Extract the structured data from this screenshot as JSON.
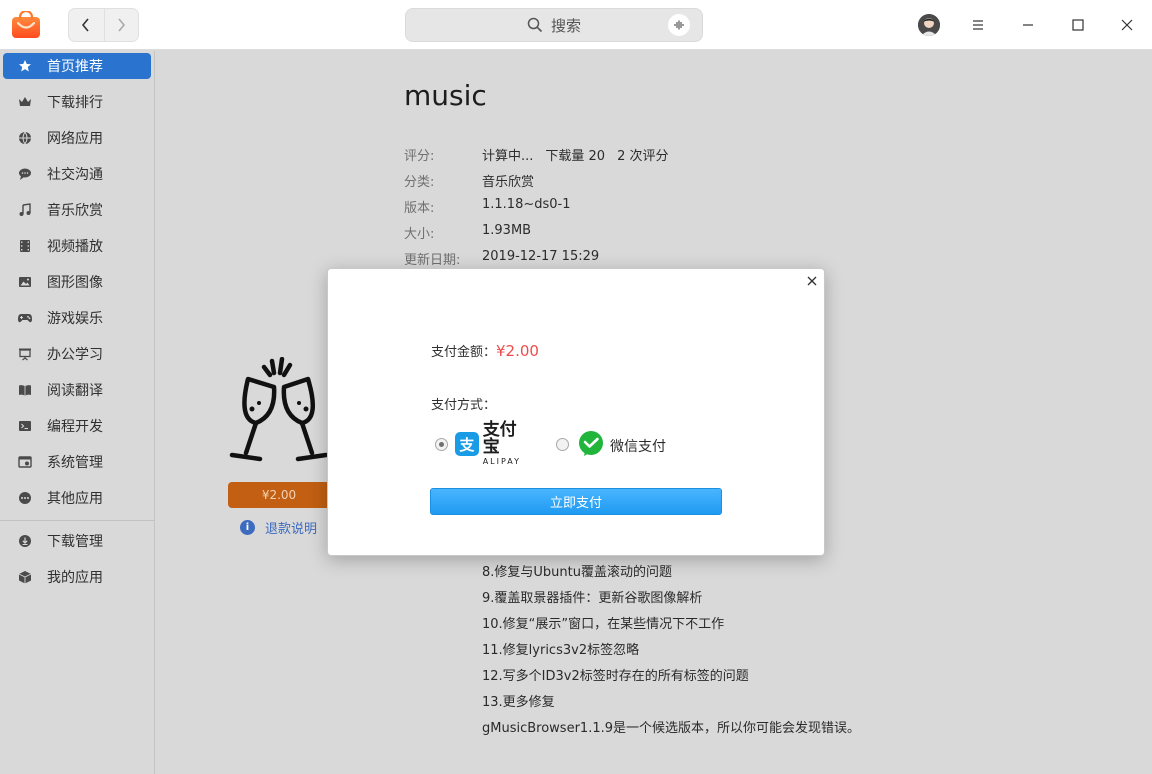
{
  "titlebar": {
    "search_label": "搜索",
    "icons": [
      "app-logo-icon",
      "back-icon",
      "forward-icon",
      "search-icon",
      "voice-icon",
      "avatar",
      "menu-icon",
      "minimize-icon",
      "maximize-icon",
      "close-icon"
    ]
  },
  "sidebar": {
    "items": [
      {
        "label": "首页推荐",
        "icon": "star-icon",
        "active": true
      },
      {
        "label": "下载排行",
        "icon": "crown-icon"
      },
      {
        "label": "网络应用",
        "icon": "globe-icon"
      },
      {
        "label": "社交沟通",
        "icon": "chat-icon"
      },
      {
        "label": "音乐欣赏",
        "icon": "music-icon"
      },
      {
        "label": "视频播放",
        "icon": "film-icon"
      },
      {
        "label": "图形图像",
        "icon": "image-icon"
      },
      {
        "label": "游戏娱乐",
        "icon": "gamepad-icon"
      },
      {
        "label": "办公学习",
        "icon": "presentation-icon"
      },
      {
        "label": "阅读翻译",
        "icon": "book-icon"
      },
      {
        "label": "编程开发",
        "icon": "terminal-icon"
      },
      {
        "label": "系统管理",
        "icon": "system-icon"
      },
      {
        "label": "其他应用",
        "icon": "more-icon"
      }
    ],
    "bottom_items": [
      {
        "label": "下载管理",
        "icon": "download-icon"
      },
      {
        "label": "我的应用",
        "icon": "box-icon"
      }
    ]
  },
  "app": {
    "name": "music",
    "meta": [
      {
        "key": "评分:",
        "values": [
          "计算中...",
          "下载量 20",
          "2 次评分"
        ]
      },
      {
        "key": "分类:",
        "values": [
          "音乐欣赏"
        ]
      },
      {
        "key": "版本:",
        "values": [
          "1.1.18~ds0-1"
        ]
      },
      {
        "key": "大小:",
        "values": [
          "1.93MB"
        ]
      },
      {
        "key": "更新日期:",
        "values": [
          "2019-12-17 15:29"
        ]
      }
    ],
    "price_label": "¥2.00",
    "refund_label": "退款说明",
    "changelog": [
      "8.修复与Ubuntu覆盖滚动的问题",
      "9.覆盖取景器插件：更新谷歌图像解析",
      "10.修复“展示”窗口，在某些情况下不工作",
      "11.修复lyrics3v2标签忽略",
      "12.写多个ID3v2标签时存在的所有标签的问题",
      "13.更多修复",
      "gMusicBrowser1.1.9是一个候选版本，所以你可能会发现错误。"
    ]
  },
  "dialog": {
    "amount_label": "支付金额：",
    "amount_value": "¥2.00",
    "method_label": "支付方式：",
    "alipay_cn": "支付宝",
    "alipay_en": "ALIPAY",
    "alipay_mark": "支",
    "wechat_label": "微信支付",
    "pay_button": "立即支付",
    "selected_method": "alipay"
  },
  "colors": {
    "accent": "#2a74d0",
    "price_button": "#c25f12",
    "amount": "#ef4b4b",
    "pay_button": "#2fa6f7",
    "alipay": "#1a9be6",
    "wechat": "#22b53c"
  }
}
